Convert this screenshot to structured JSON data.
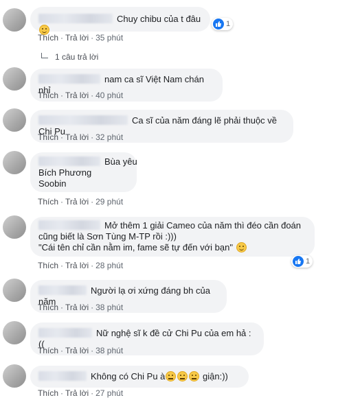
{
  "actions": {
    "like": "Thích",
    "reply": "Trả lời"
  },
  "comments": [
    {
      "lines": [
        "Chuy chibu của t đâu"
      ],
      "emoji": "smile",
      "time": "35 phút",
      "reactions": "1"
    },
    {
      "lines": [
        "nam ca sĩ Việt Nam chán nhỉ"
      ],
      "time": "40 phút"
    },
    {
      "lines": [
        "Ca sĩ của năm đáng lẽ phải thuộc về Chi Pu"
      ],
      "time": "32 phút"
    },
    {
      "lines": [
        "Bùa yêu",
        "Bích Phương",
        "Soobin"
      ],
      "time": "29 phút"
    },
    {
      "lines": [
        "Mở thêm 1 giải Cameo của năm thì đéo cần đoán",
        "cũng biết là Sơn Tùng M-TP rồi :)))",
        "\"Cái tên chỉ cần nằm im, fame sẽ tự đến với bạn\""
      ],
      "emoji": "smile",
      "time": "28 phút",
      "reactions": "1"
    },
    {
      "lines": [
        "Người lạ ơi xứng đáng bh của năm"
      ],
      "time": "38 phút"
    },
    {
      "lines": [
        "Nữ nghệ sĩ k đề cử Chi Pu của em hả :(("
      ],
      "time": "38 phút"
    },
    {
      "lines": [
        "Không có Chi Pu à",
        " giận:))"
      ],
      "time": "27 phút"
    }
  ],
  "reply_count": "1 câu trả lời",
  "icons": {
    "like": "like-icon",
    "reply": "reply-arrow-icon",
    "emoji": "smile-emoji-icon"
  },
  "colors": {
    "like_blue": "#1877f2",
    "bubble_bg": "#f2f3f5",
    "meta_gray": "#606770"
  }
}
